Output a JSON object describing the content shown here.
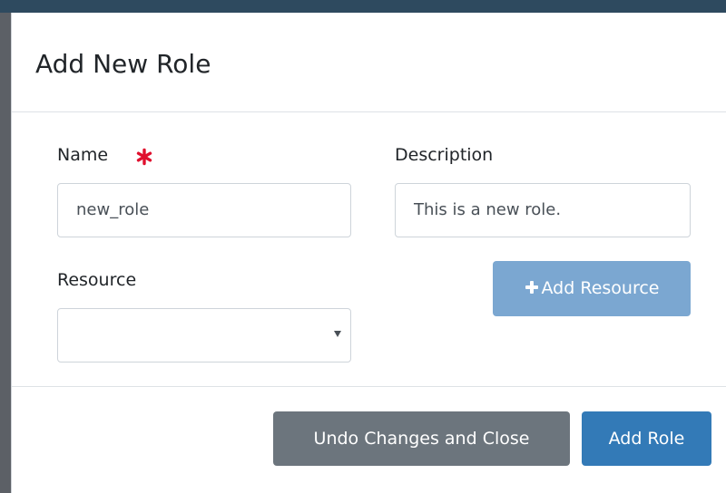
{
  "modal": {
    "title": "Add New Role"
  },
  "form": {
    "name": {
      "label": "Name",
      "value": "new_role",
      "required": true
    },
    "description": {
      "label": "Description",
      "value": "This is a new role."
    },
    "resource": {
      "label": "Resource",
      "selected": ""
    },
    "add_resource_label": "Add Resource"
  },
  "footer": {
    "undo_label": "Undo Changes and Close",
    "add_role_label": "Add Role"
  },
  "colors": {
    "primary": "#337ab7",
    "primary_disabled": "#7ba7d1",
    "secondary": "#6c757d",
    "required_marker": "#e0102e"
  },
  "icons": {
    "required": "asterisk-icon",
    "add_resource": "plus-icon",
    "dropdown": "caret-down-icon"
  }
}
